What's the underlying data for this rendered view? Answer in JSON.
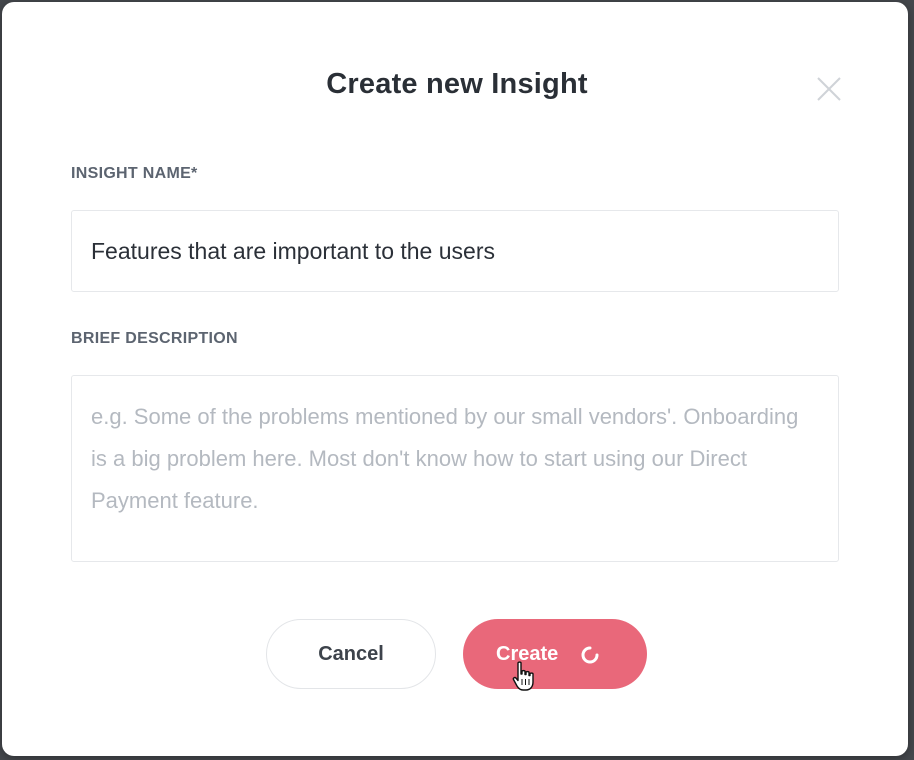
{
  "dialog": {
    "title": "Create new Insight",
    "close_icon": "close-icon"
  },
  "form": {
    "name_label": "INSIGHT NAME*",
    "name_value": "Features that are important to the users",
    "description_label": "BRIEF DESCRIPTION",
    "description_value": "",
    "description_placeholder": "e.g. Some of the problems mentioned by our small vendors'. Onboarding is a big problem here. Most don't know how to start using our Direct Payment feature."
  },
  "actions": {
    "cancel_label": "Cancel",
    "create_label": "Create",
    "create_state_icon": "loading-spinner-icon",
    "pointer_icon": "hand-pointer-cursor-icon"
  },
  "colors": {
    "accent": "#e9687a",
    "title": "#2a2f36",
    "label": "#5c6470",
    "placeholder": "#b4b9c0"
  }
}
